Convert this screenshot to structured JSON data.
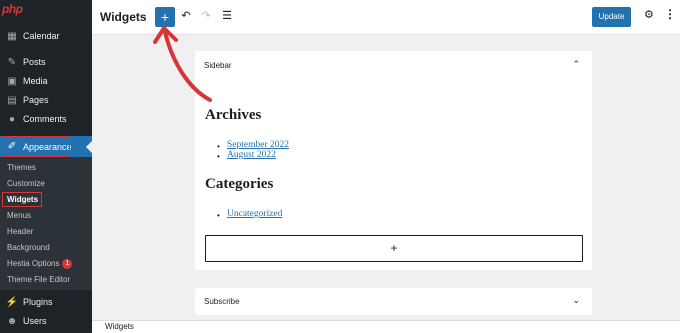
{
  "logo": "php",
  "sidebar": {
    "items": [
      {
        "label": "Calendar",
        "icon": "calendar-icon"
      },
      {
        "label": "Posts",
        "icon": "pushpin-icon"
      },
      {
        "label": "Media",
        "icon": "media-icon"
      },
      {
        "label": "Pages",
        "icon": "pages-icon"
      },
      {
        "label": "Comments",
        "icon": "comment-icon"
      },
      {
        "label": "Appearance",
        "icon": "brush-icon"
      },
      {
        "label": "Plugins",
        "icon": "plug-icon"
      },
      {
        "label": "Users",
        "icon": "user-icon"
      }
    ],
    "submenu": [
      "Themes",
      "Customize",
      "Widgets",
      "Menus",
      "Header",
      "Background",
      "Hestia Options",
      "Theme File Editor"
    ],
    "badge": "1"
  },
  "topbar": {
    "title": "Widgets",
    "add_label": "+",
    "update_label": "Update"
  },
  "sidebar_panel": {
    "header": "Sidebar",
    "archives_heading": "Archives",
    "archive_links": [
      "September 2022",
      "August 2022"
    ],
    "categories_heading": "Categories",
    "category_links": [
      "Uncategorized"
    ],
    "add_block": "+"
  },
  "subscribe_panel": {
    "header": "Subscribe"
  },
  "footer": {
    "breadcrumb": "Widgets"
  },
  "colors": {
    "accent": "#2271b1",
    "annotation_red": "#d63638",
    "admin_bar": "#1d2327"
  }
}
